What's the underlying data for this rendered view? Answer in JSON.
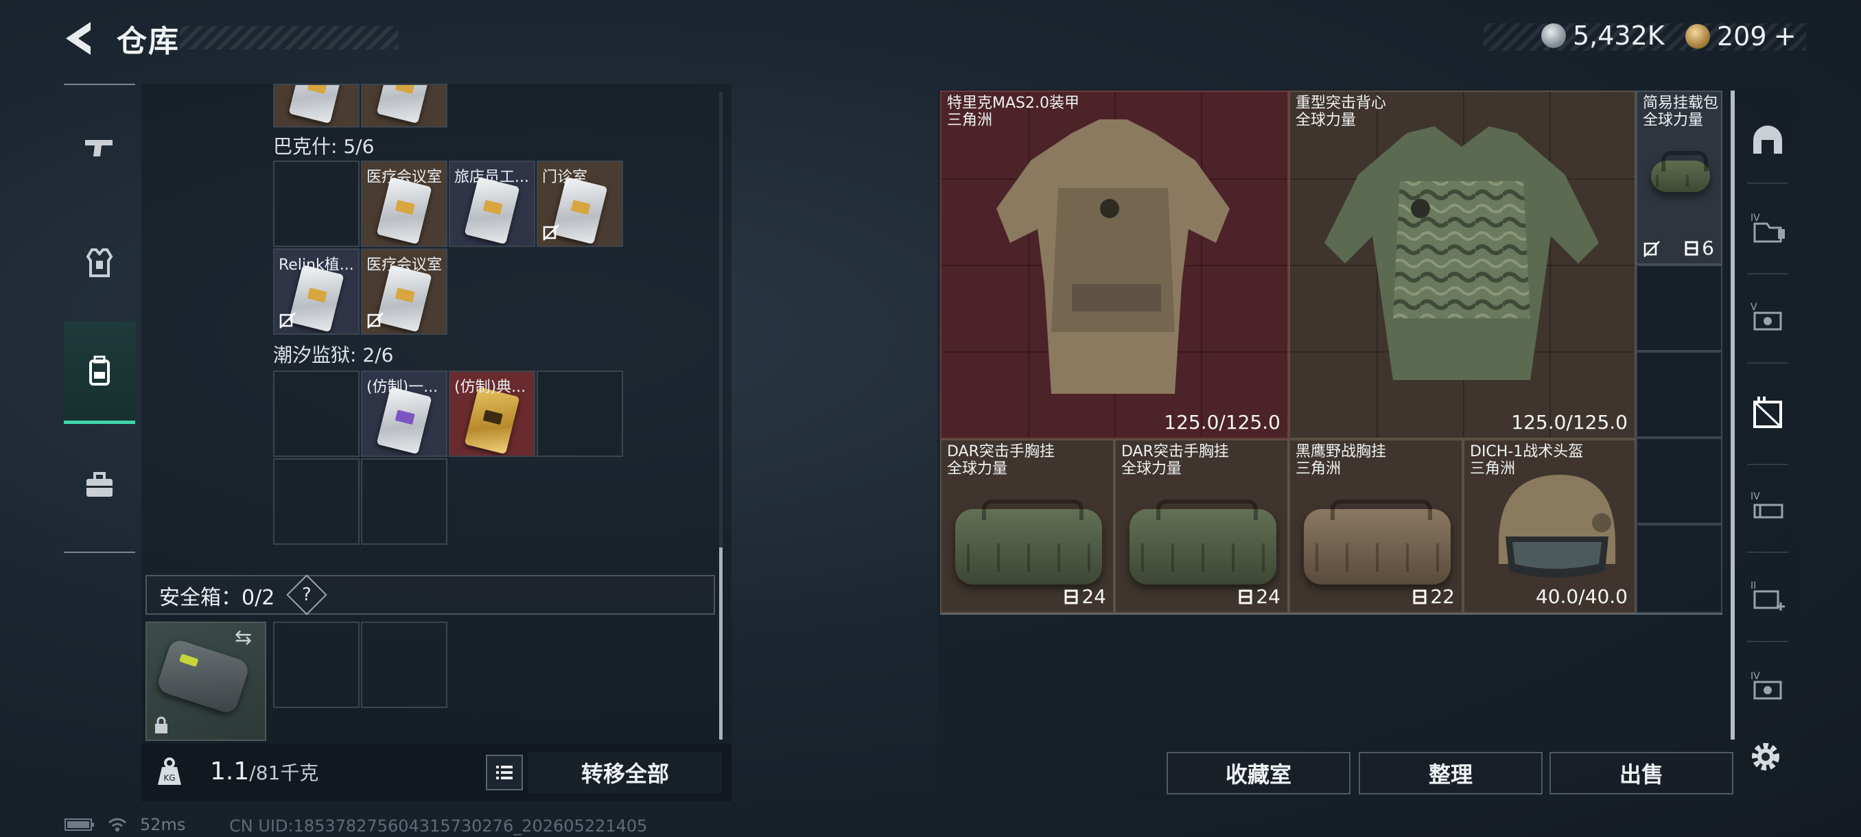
{
  "header": {
    "title": "仓库"
  },
  "currency": {
    "silver": "5,432K",
    "gold": "209"
  },
  "left_nav": {
    "items": [
      "weapons",
      "armor",
      "backpack",
      "toolbox"
    ],
    "active_index": 2
  },
  "storage": {
    "groups": [
      {
        "label": "巴克什: 5/6",
        "slots": [
          {
            "name": ""
          },
          {
            "name": "医疗会议室"
          },
          {
            "name": "旅店员工..."
          },
          {
            "name": "门诊室"
          },
          {
            "name": "Relink植..."
          },
          {
            "name": "医疗会议室"
          }
        ]
      },
      {
        "label": "潮汐监狱: 2/6",
        "slots": [
          {
            "name": ""
          },
          {
            "name": "(仿制)一..."
          },
          {
            "name": "(仿制)典..."
          },
          {
            "name": ""
          },
          {
            "name": ""
          },
          {
            "name": ""
          }
        ]
      }
    ]
  },
  "safe_box": {
    "label": "安全箱：0/2",
    "help": "?"
  },
  "footer_left": {
    "weight_value": "1.1",
    "weight_max": "/81千克",
    "transfer_all": "转移全部"
  },
  "equipment": [
    {
      "name": "特里克MAS2.0装甲",
      "origin": "三角洲",
      "durability": "125.0/125.0"
    },
    {
      "name": "重型突击背心",
      "origin": "全球力量",
      "durability": "125.0/125.0"
    },
    {
      "name": "简易挂载包",
      "origin": "全球力量",
      "count": "6"
    },
    {
      "name": "DAR突击手胸挂",
      "origin": "全球力量",
      "count": "24"
    },
    {
      "name": "DAR突击手胸挂",
      "origin": "全球力量",
      "count": "24"
    },
    {
      "name": "黑鹰野战胸挂",
      "origin": "三角洲",
      "count": "22"
    },
    {
      "name": "DICH-1战术头盔",
      "origin": "三角洲",
      "durability": "40.0/40.0"
    }
  ],
  "buttons": {
    "collection": "收藏室",
    "sort": "整理",
    "sell": "出售"
  },
  "status_bar": {
    "ping": "52ms",
    "uid": "CN UID:1853782756043157302​76_202605221405"
  },
  "colors": {
    "accent": "#3fd7a8",
    "red_slot": "#6a2b2e",
    "brown_slot": "#4a3c31"
  }
}
